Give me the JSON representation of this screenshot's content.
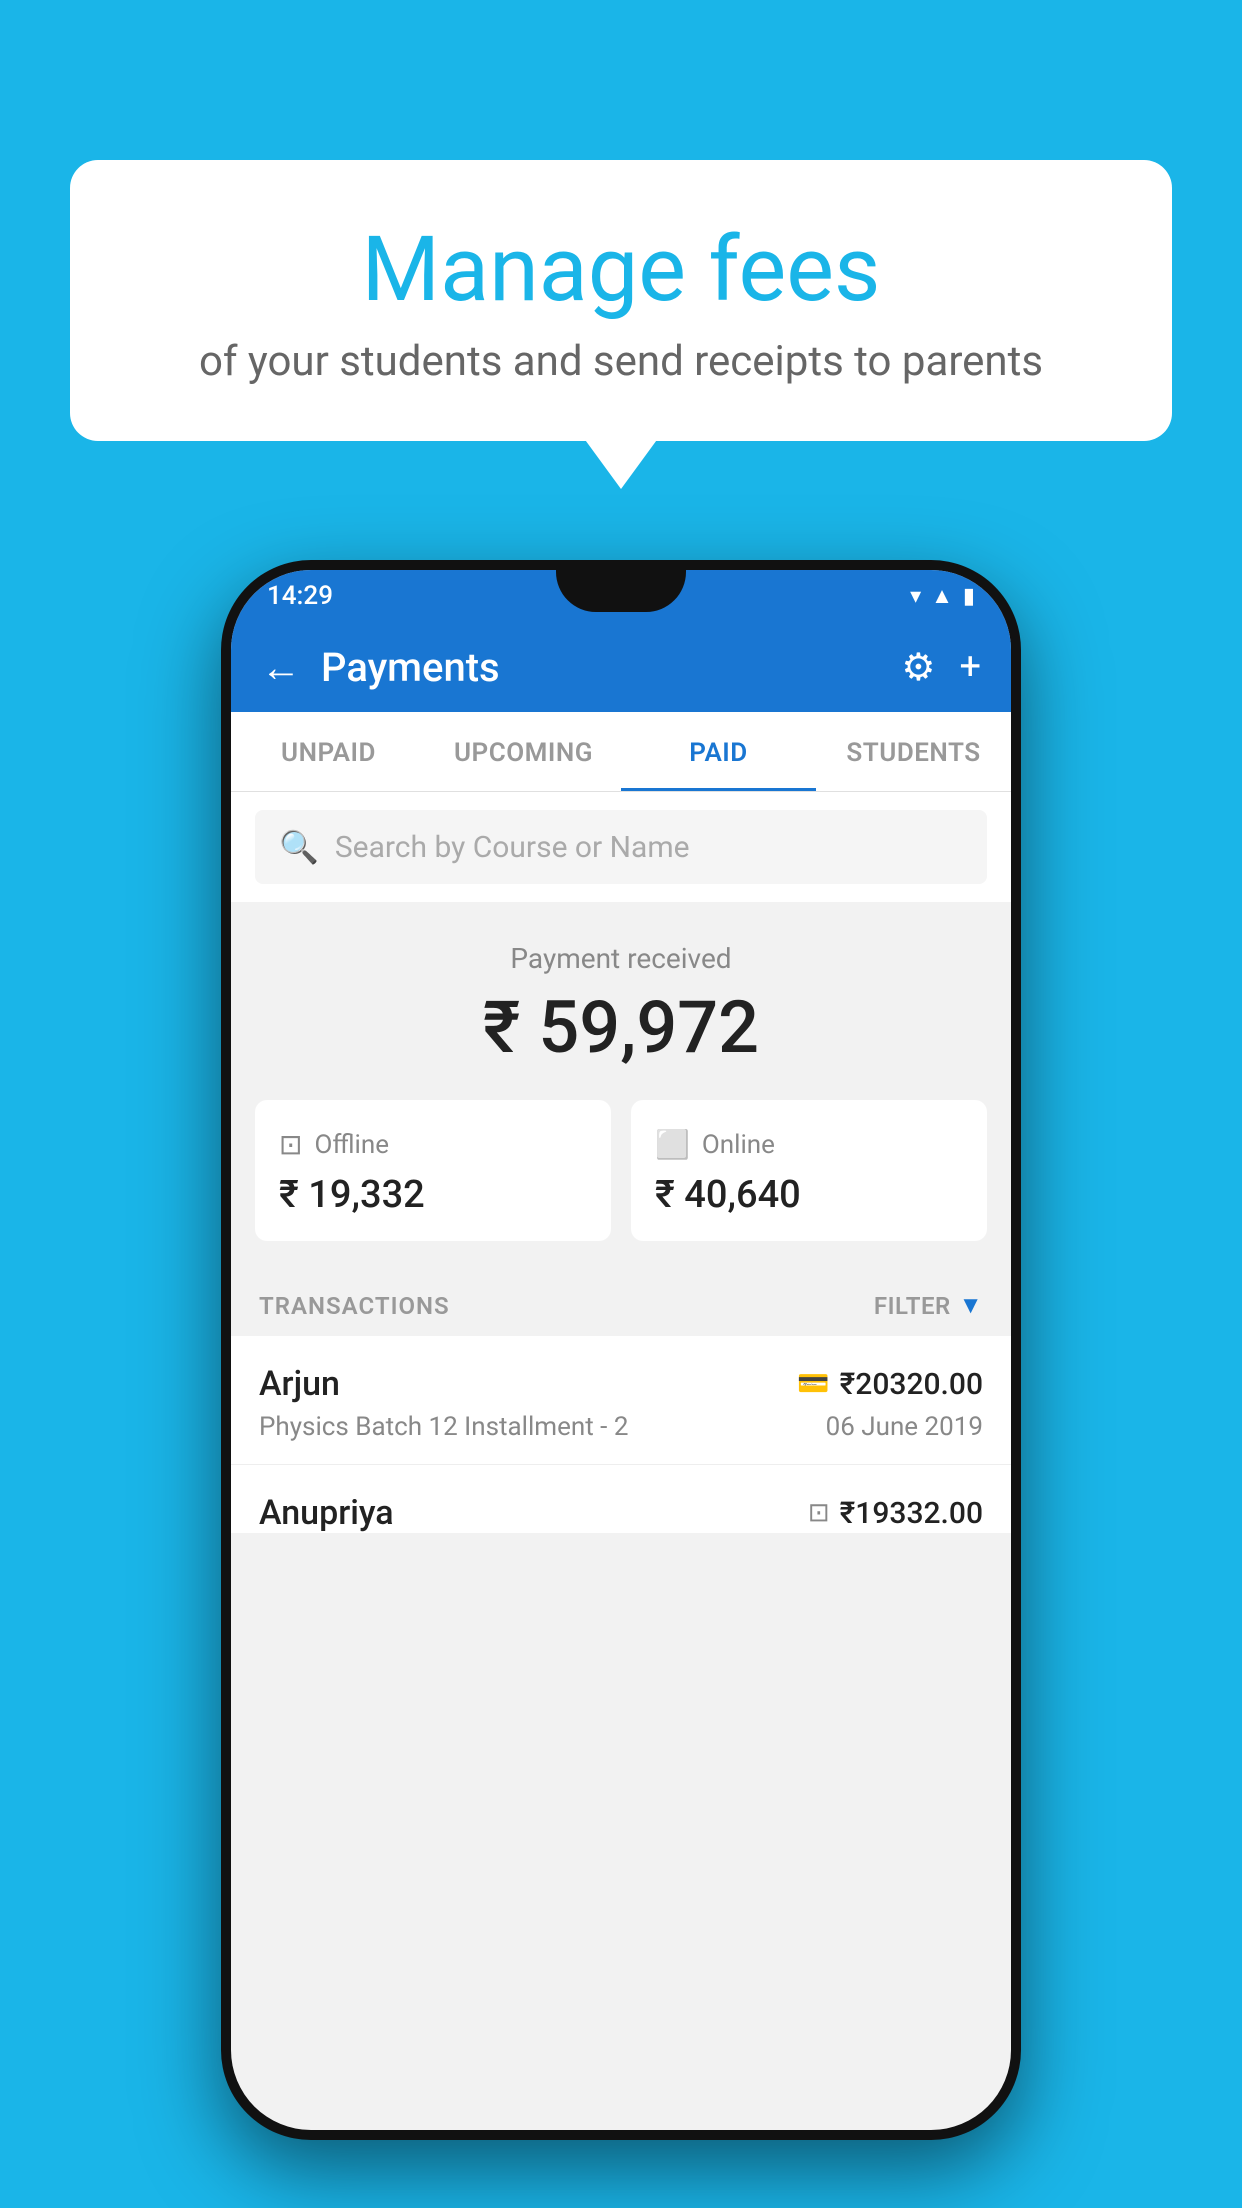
{
  "background_color": "#1ab5e8",
  "speech_bubble": {
    "heading": "Manage fees",
    "subtext": "of your students and send receipts to parents"
  },
  "phone": {
    "status_bar": {
      "time": "14:29"
    },
    "app_bar": {
      "title": "Payments",
      "back_label": "←",
      "gear_label": "⚙",
      "plus_label": "+"
    },
    "tabs": [
      {
        "label": "UNPAID",
        "active": false
      },
      {
        "label": "UPCOMING",
        "active": false
      },
      {
        "label": "PAID",
        "active": true
      },
      {
        "label": "STUDENTS",
        "active": false
      }
    ],
    "search": {
      "placeholder": "Search by Course or Name"
    },
    "payment_received": {
      "label": "Payment received",
      "amount": "₹ 59,972"
    },
    "payment_cards": [
      {
        "icon": "offline",
        "label": "Offline",
        "amount": "₹ 19,332"
      },
      {
        "icon": "online",
        "label": "Online",
        "amount": "₹ 40,640"
      }
    ],
    "transactions": {
      "label": "TRANSACTIONS",
      "filter_label": "FILTER",
      "items": [
        {
          "name": "Arjun",
          "course": "Physics Batch 12 Installment - 2",
          "amount": "₹20320.00",
          "date": "06 June 2019",
          "payment_type": "online"
        },
        {
          "name": "Anupriya",
          "course": "",
          "amount": "₹19332.00",
          "date": "",
          "payment_type": "offline"
        }
      ]
    }
  }
}
